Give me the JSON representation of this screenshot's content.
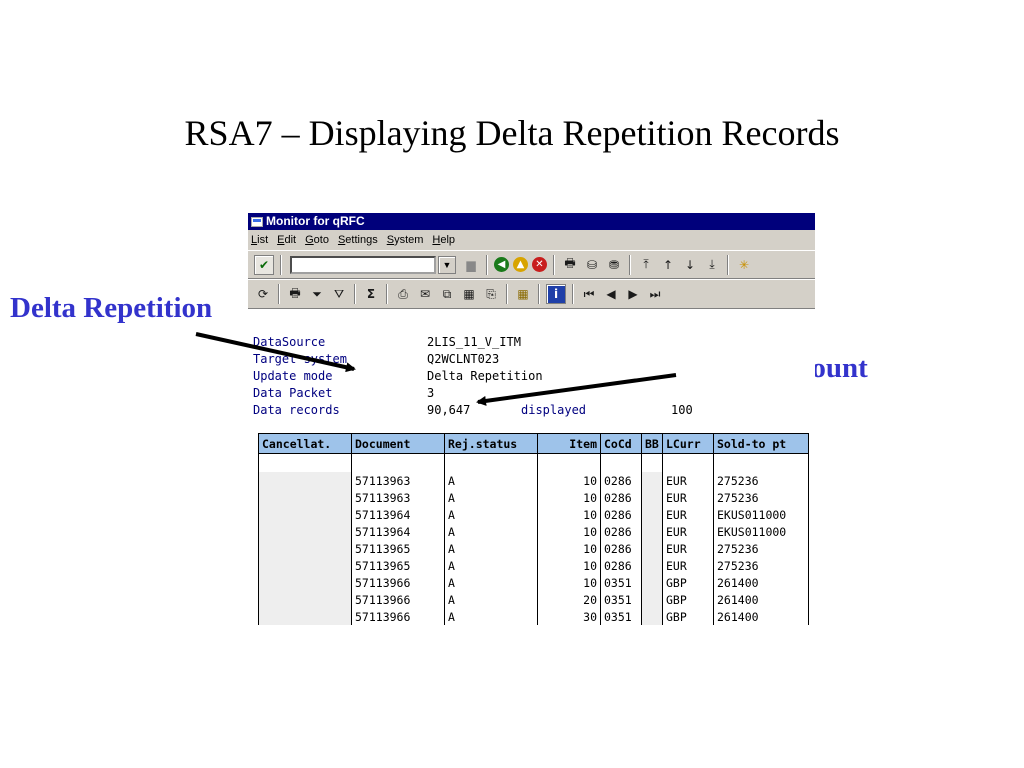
{
  "slide": {
    "title": "RSA7 – Displaying Delta Repetition Records",
    "callout_delta": "Delta Repetition",
    "callout_count": "Record Count"
  },
  "window": {
    "title": "Monitor for qRFC",
    "menu": [
      "List",
      "Edit",
      "Goto",
      "Settings",
      "System",
      "Help"
    ],
    "command_field": {
      "value": ""
    }
  },
  "header": {
    "datasource_label": "DataSource",
    "datasource_value": "2LIS_11_V_ITM",
    "target_label": "Target system",
    "target_value": "Q2WCLNT023",
    "update_label": "Update mode",
    "update_value": "Delta Repetition",
    "packet_label": "Data Packet",
    "packet_value": "3",
    "records_label": "Data records",
    "records_value": "90,647",
    "displayed_label": "displayed",
    "displayed_value": "100"
  },
  "table": {
    "columns": [
      "Cancellat.",
      "Document",
      "Rej.status",
      "Item",
      "CoCd",
      "BB",
      "LCurr",
      "Sold-to pt"
    ],
    "rows": [
      [
        "",
        "57113963",
        "A",
        "10",
        "0286",
        "",
        "EUR",
        "275236"
      ],
      [
        "",
        "57113963",
        "A",
        "10",
        "0286",
        "",
        "EUR",
        "275236"
      ],
      [
        "",
        "57113964",
        "A",
        "10",
        "0286",
        "",
        "EUR",
        "EKUS011000"
      ],
      [
        "",
        "57113964",
        "A",
        "10",
        "0286",
        "",
        "EUR",
        "EKUS011000"
      ],
      [
        "",
        "57113965",
        "A",
        "10",
        "0286",
        "",
        "EUR",
        "275236"
      ],
      [
        "",
        "57113965",
        "A",
        "10",
        "0286",
        "",
        "EUR",
        "275236"
      ],
      [
        "",
        "57113966",
        "A",
        "10",
        "0351",
        "",
        "GBP",
        "261400"
      ],
      [
        "",
        "57113966",
        "A",
        "20",
        "0351",
        "",
        "GBP",
        "261400"
      ],
      [
        "",
        "57113966",
        "A",
        "30",
        "0351",
        "",
        "GBP",
        "261400"
      ]
    ]
  },
  "colors": {
    "titlebar": "#00007b",
    "callout": "#3333cc",
    "header_cell": "#9ec3ea",
    "chrome": "#d4d0c8"
  },
  "icons": [
    "enter-icon",
    "save-icon",
    "back-icon",
    "exit-icon",
    "cancel-icon",
    "print-icon",
    "find-icon",
    "find-next-icon",
    "first-page-icon",
    "prev-page-icon",
    "next-page-icon",
    "last-page-icon",
    "create-session-icon",
    "layout-icon"
  ]
}
